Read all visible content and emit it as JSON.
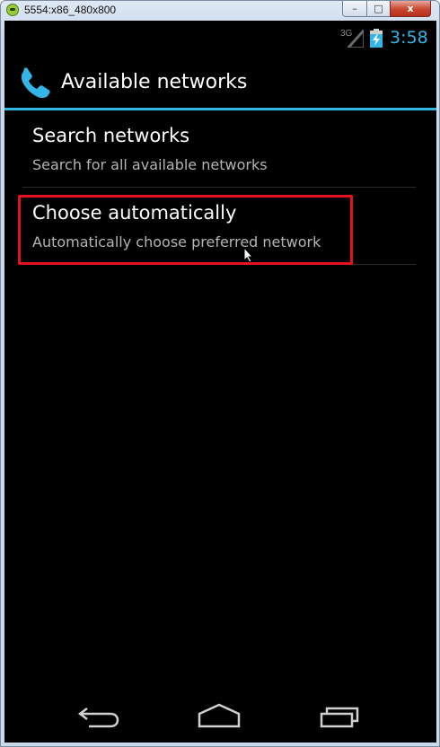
{
  "window": {
    "title": "5554:x86_480x800",
    "minimize_label": "–",
    "maximize_label": "□",
    "close_label": "x"
  },
  "status_bar": {
    "network_type": "3G",
    "time": "3:58",
    "accent_color": "#33b5e5"
  },
  "action_bar": {
    "icon": "phone-icon",
    "title": "Available networks"
  },
  "preferences": [
    {
      "title": "Search networks",
      "summary": "Search for all available networks"
    },
    {
      "title": "Choose automatically",
      "summary": "Automatically choose preferred network",
      "highlighted": true
    }
  ],
  "navigation_bar": {
    "buttons": [
      "back-icon",
      "home-icon",
      "recent-apps-icon"
    ]
  },
  "colors": {
    "background": "#000000",
    "highlight": "#e4131b",
    "summary_text": "#b4b4b4"
  }
}
